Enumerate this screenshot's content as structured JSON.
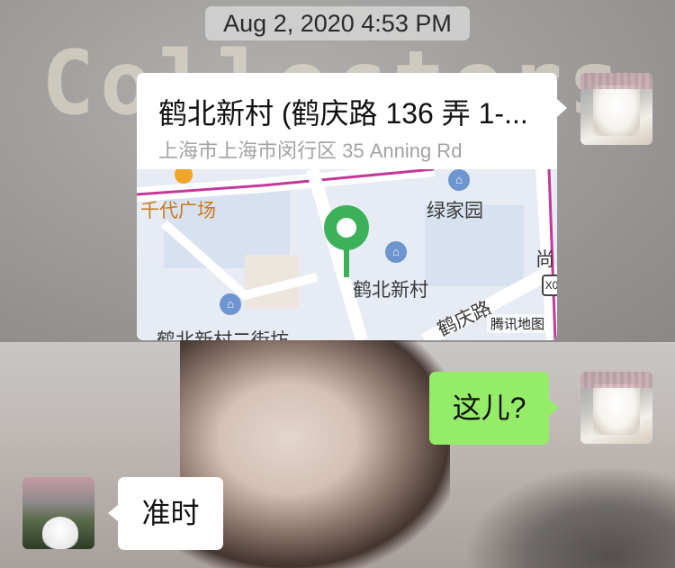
{
  "timestamp": "Aug 2, 2020 4:53 PM",
  "background_text": "Collecters",
  "location_message": {
    "title": "鹤北新村 (鹤庆路 136 弄 1-...",
    "address": "上海市上海市闵行区 35 Anning Rd",
    "map": {
      "labels": {
        "mall": "千代广场",
        "green_home": "绿家园",
        "village": "鹤北新村",
        "street": "鹤北新村二街坊",
        "road": "鹤庆路",
        "edge": "尚",
        "badge": "X0",
        "brand": "腾讯地图"
      },
      "colors": {
        "pin": "#3cb15a",
        "poi": "#6d95cf",
        "road_highlight": "#c2389b"
      }
    }
  },
  "messages": [
    {
      "sender": "me",
      "text": "这儿?",
      "bubble_color": "#95ec69"
    },
    {
      "sender": "other",
      "text": "准时",
      "bubble_color": "#ffffff"
    }
  ]
}
